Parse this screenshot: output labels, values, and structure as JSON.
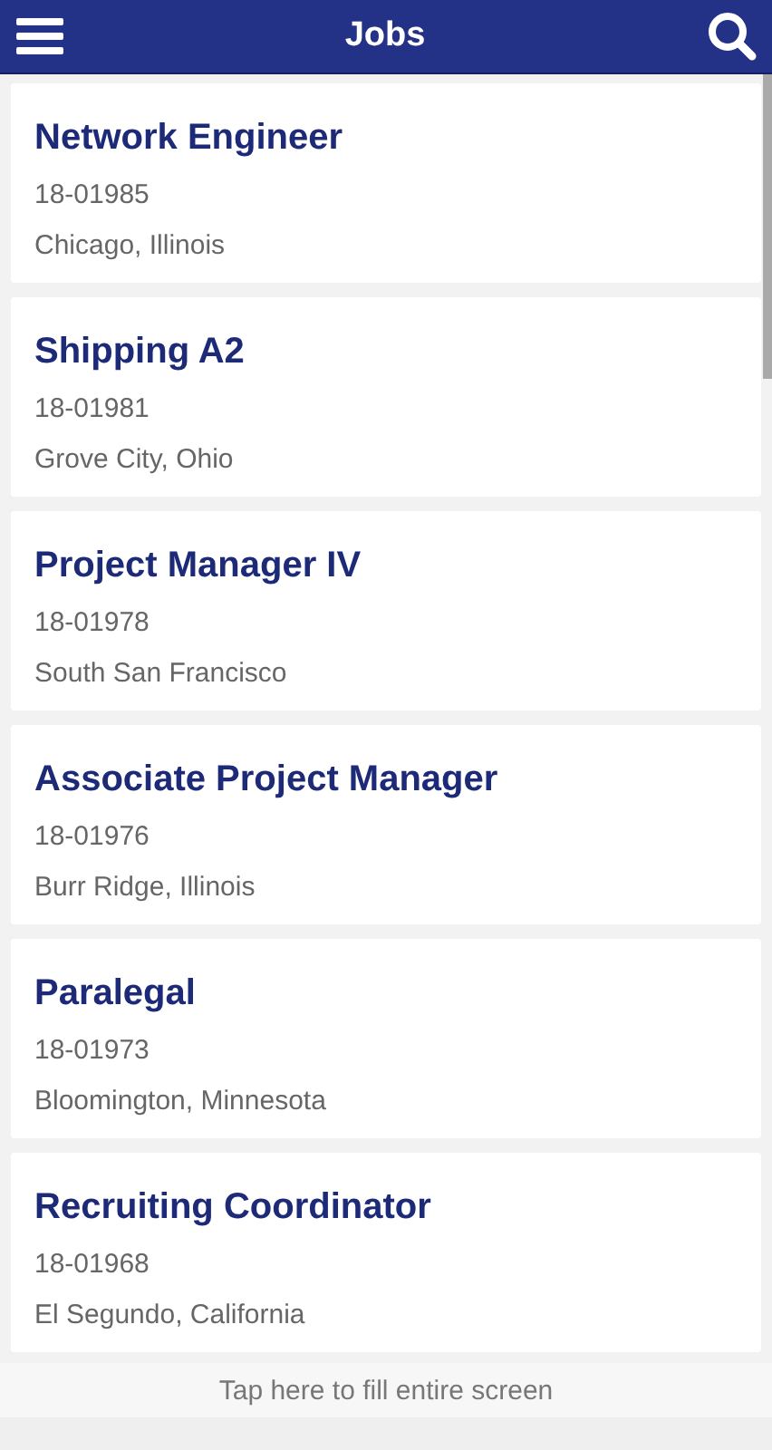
{
  "header": {
    "title": "Jobs"
  },
  "jobs": [
    {
      "title": "Network Engineer",
      "id": "18-01985",
      "location": "Chicago, Illinois"
    },
    {
      "title": "Shipping A2",
      "id": "18-01981",
      "location": "Grove City, Ohio"
    },
    {
      "title": "Project Manager IV",
      "id": "18-01978",
      "location": "South San Francisco"
    },
    {
      "title": "Associate Project Manager",
      "id": "18-01976",
      "location": "Burr Ridge, Illinois"
    },
    {
      "title": "Paralegal",
      "id": "18-01973",
      "location": "Bloomington, Minnesota"
    },
    {
      "title": "Recruiting Coordinator",
      "id": "18-01968",
      "location": "El Segundo, California"
    }
  ],
  "fill_screen_bar": {
    "label": "Tap here to fill entire screen"
  }
}
